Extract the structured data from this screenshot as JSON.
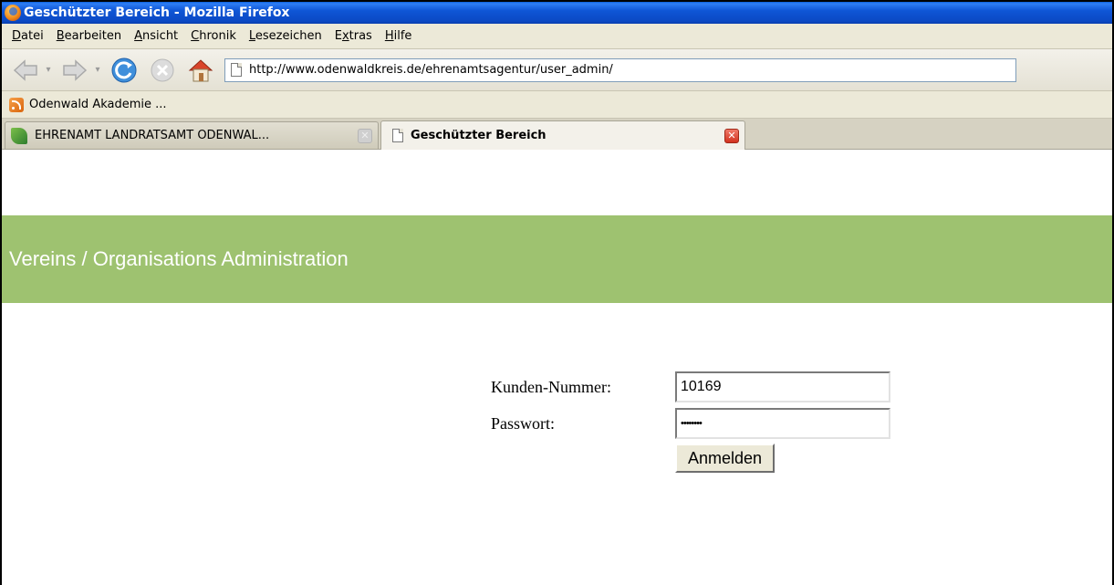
{
  "window": {
    "title": "Geschützter Bereich - Mozilla Firefox"
  },
  "menu": {
    "items": [
      {
        "pre": "",
        "u": "D",
        "post": "atei"
      },
      {
        "pre": "",
        "u": "B",
        "post": "earbeiten"
      },
      {
        "pre": "",
        "u": "A",
        "post": "nsicht"
      },
      {
        "pre": "",
        "u": "C",
        "post": "hronik"
      },
      {
        "pre": "",
        "u": "L",
        "post": "esezeichen"
      },
      {
        "pre": "E",
        "u": "x",
        "post": "tras"
      },
      {
        "pre": "",
        "u": "H",
        "post": "ilfe"
      }
    ]
  },
  "navigation": {
    "url": "http://www.odenwaldkreis.de/ehrenamtsagentur/user_admin/"
  },
  "bookmarks": {
    "items": [
      {
        "label": "Odenwald Akademie ...",
        "icon": "rss-icon"
      }
    ]
  },
  "tabs": [
    {
      "label": "EHRENAMT LANDRATSAMT ODENWAL...",
      "active": false,
      "icon": "leaf-favicon"
    },
    {
      "label": "Geschützter Bereich",
      "active": true,
      "icon": "page-icon"
    }
  ],
  "page": {
    "banner_title": "Vereins / Organisations Administration",
    "banner_color": "#9ec270",
    "login": {
      "customer_label": "Kunden-Nummer:",
      "customer_value": "10169",
      "password_label": "Passwort:",
      "password_value": "********",
      "submit_label": "Anmelden"
    }
  }
}
